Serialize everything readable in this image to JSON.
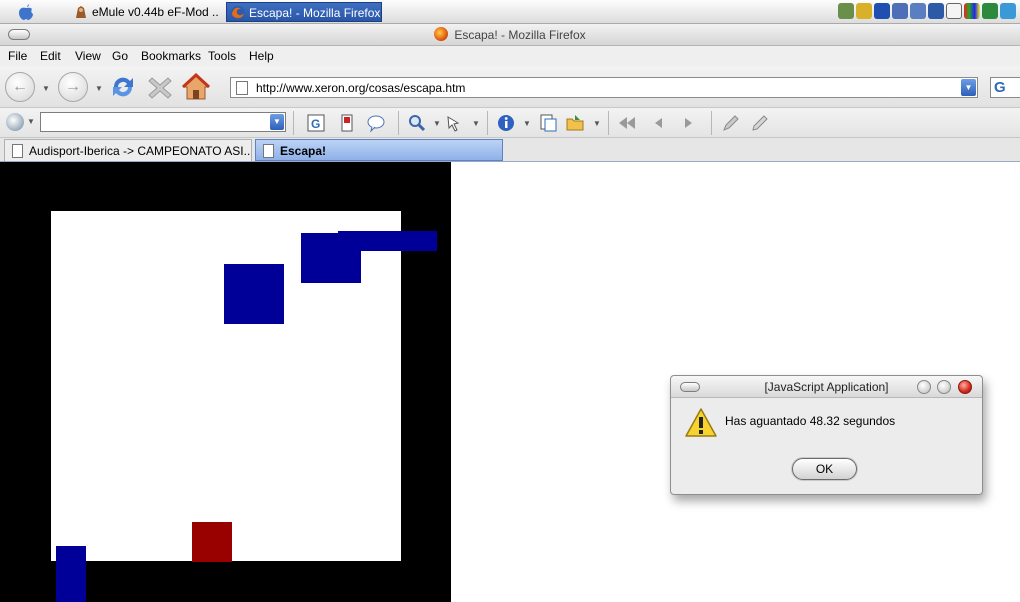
{
  "taskbar": {
    "tasks": [
      {
        "label": "eMule v0.44b eF-Mod ...",
        "icon": "emule-icon"
      },
      {
        "label": "Escapa! - Mozilla Firefox",
        "icon": "firefox-icon"
      }
    ],
    "tray_icons": [
      "user-icon",
      "network-icon",
      "bluetooth-icon",
      "volume-icon",
      "monitor-icon",
      "mail-icon",
      "tag-icon",
      "color-icon",
      "security-icon",
      "globe-icon"
    ]
  },
  "window": {
    "title": "Escapa! - Mozilla Firefox"
  },
  "menubar": {
    "items": [
      "File",
      "Edit",
      "View",
      "Go",
      "Bookmarks",
      "Tools",
      "Help"
    ]
  },
  "navbar": {
    "buttons": [
      "back-icon",
      "forward-icon",
      "reload-icon",
      "stop-icon",
      "home-icon"
    ],
    "url": "http://www.xeron.org/cosas/escapa.htm",
    "search_engine_label": "G"
  },
  "google_toolbar": {
    "search_value": "",
    "icons": [
      "google-icon",
      "pagerank-icon",
      "chat-icon",
      "zoom-icon",
      "select-icon",
      "info-icon",
      "view-source-icon",
      "folder-icon",
      "rewind-icon",
      "back-arrow-icon",
      "forward-arrow-icon",
      "pen-icon",
      "pencil-icon"
    ]
  },
  "tabs": [
    {
      "label": "Audisport-Iberica -> CAMPEONATO ASI...i...",
      "active": false
    },
    {
      "label": "Escapa!",
      "active": true
    }
  ],
  "game": {
    "colors": {
      "border": "#000000",
      "arena": "#ffffff",
      "enemy": "#000099",
      "player": "#990000"
    }
  },
  "dialog": {
    "title": "[JavaScript Application]",
    "message": "Has aguantado 48.32 segundos",
    "ok_label": "OK",
    "icon": "warning-icon"
  }
}
